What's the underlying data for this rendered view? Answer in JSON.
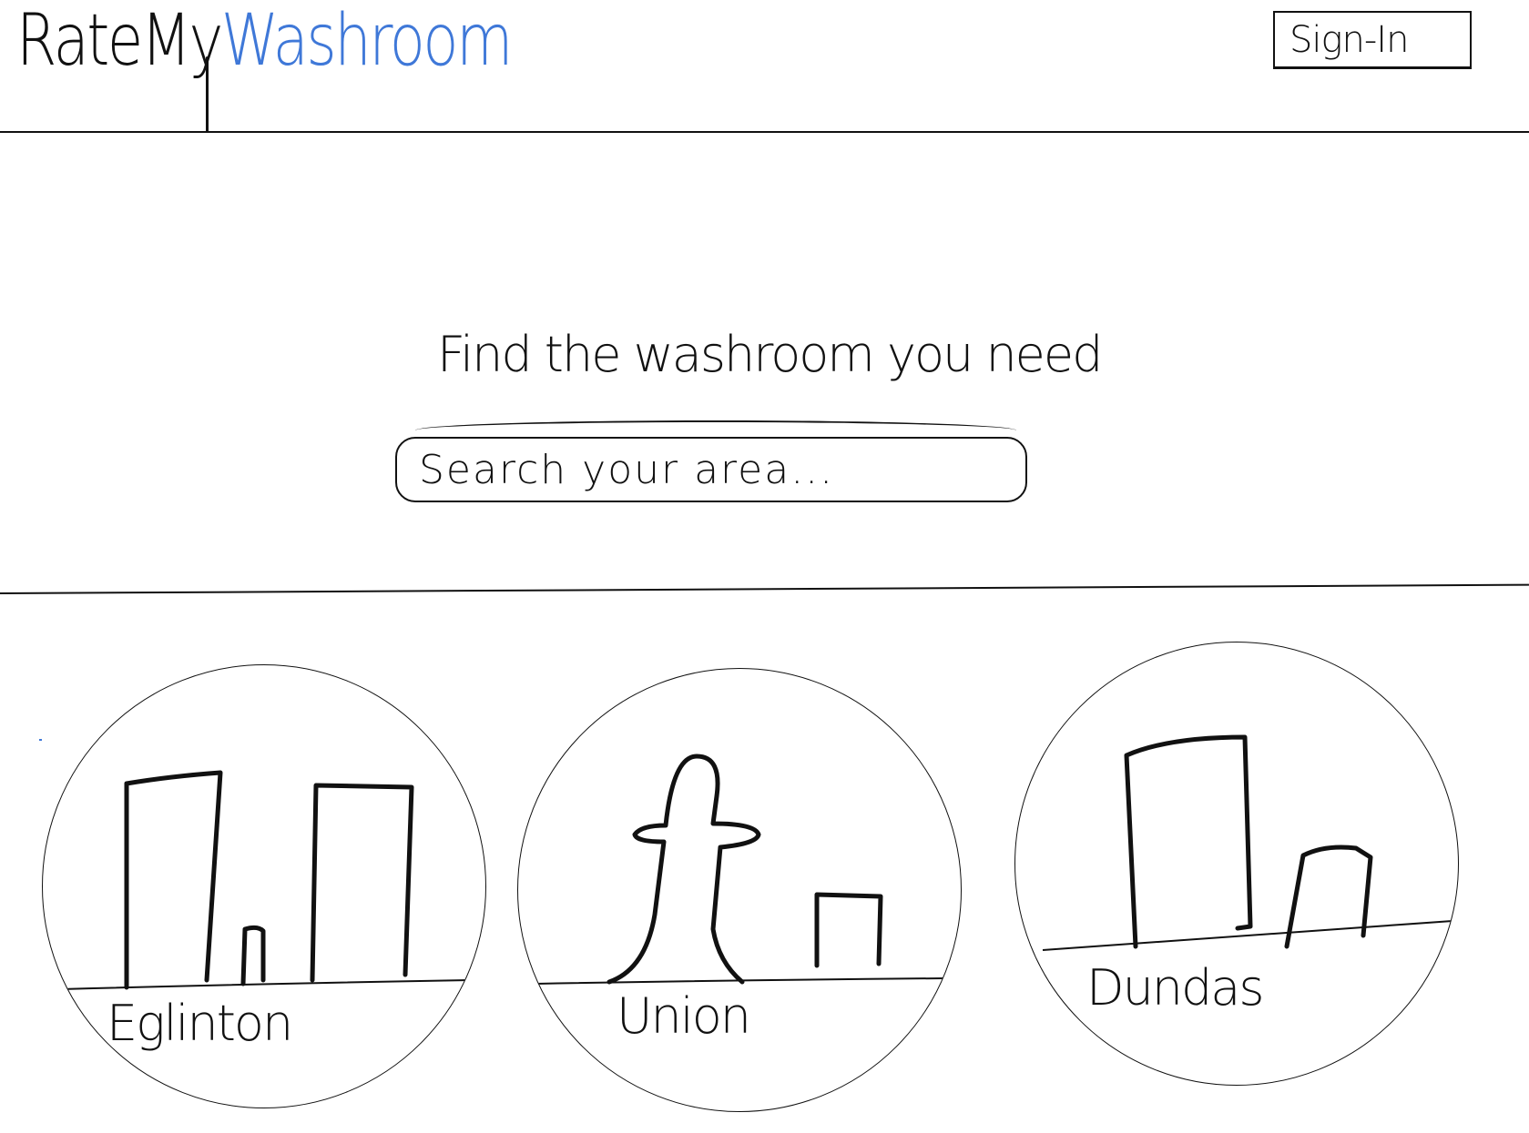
{
  "header": {
    "logo_part_a": "RateMy",
    "logo_part_b": "Washroom",
    "signin_label": "Sign-In",
    "logo_accent_color": "#3f78d8"
  },
  "hero": {
    "title": "Find the washroom you need",
    "search_placeholder": "Search your area..."
  },
  "stations": [
    {
      "name": "Eglinton",
      "icon": "city-buildings-icon"
    },
    {
      "name": "Union",
      "icon": "cn-tower-skyline-icon"
    },
    {
      "name": "Dundas",
      "icon": "city-buildings-icon"
    }
  ]
}
